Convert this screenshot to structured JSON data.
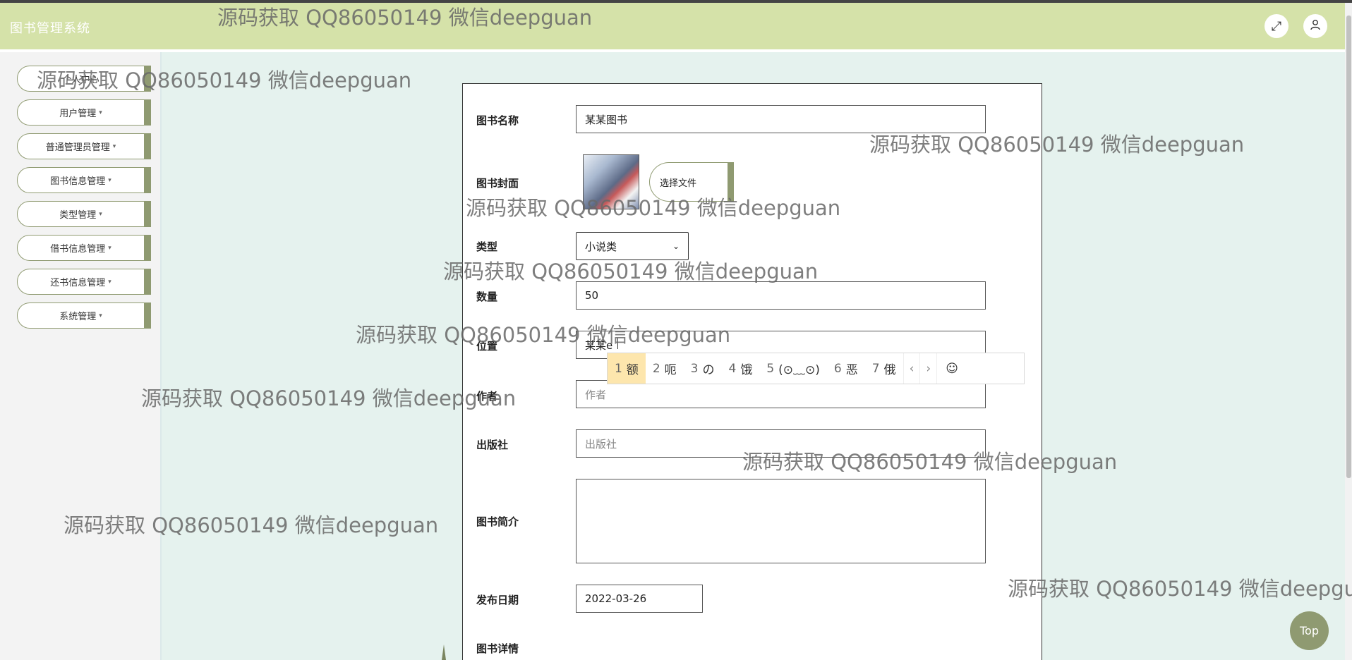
{
  "header": {
    "title": "图书管理系统",
    "fullscreen_icon": "expand-icon",
    "user_icon": "user-icon"
  },
  "sidebar": {
    "items": [
      {
        "label": "个人中心"
      },
      {
        "label": "用户管理"
      },
      {
        "label": "普通管理员管理"
      },
      {
        "label": "图书信息管理"
      },
      {
        "label": "类型管理"
      },
      {
        "label": "借书信息管理"
      },
      {
        "label": "还书信息管理"
      },
      {
        "label": "系统管理"
      }
    ]
  },
  "form": {
    "book_name": {
      "label": "图书名称",
      "value": "某某图书"
    },
    "cover": {
      "label": "图书封面",
      "button": "选择文件"
    },
    "type": {
      "label": "类型",
      "value": "小说类"
    },
    "quantity": {
      "label": "数量",
      "value": "50"
    },
    "location": {
      "label": "位置",
      "value": "某某e"
    },
    "author": {
      "label": "作者",
      "placeholder": "作者"
    },
    "publisher": {
      "label": "出版社",
      "placeholder": "出版社"
    },
    "intro": {
      "label": "图书简介"
    },
    "publish_date": {
      "label": "发布日期",
      "value": "2022-03-26"
    },
    "details": {
      "label": "图书详情"
    }
  },
  "ime": {
    "candidates": [
      {
        "num": "1",
        "text": "额"
      },
      {
        "num": "2",
        "text": "呃"
      },
      {
        "num": "3",
        "text": "の"
      },
      {
        "num": "4",
        "text": "饿"
      },
      {
        "num": "5",
        "text": "(⊙﹏⊙)"
      },
      {
        "num": "6",
        "text": "恶"
      },
      {
        "num": "7",
        "text": "俄"
      }
    ],
    "prev": "‹",
    "next": "›",
    "emoji": "☺"
  },
  "watermark_text": "源码获取 QQ86050149 微信deepguan",
  "top_button": "Top"
}
